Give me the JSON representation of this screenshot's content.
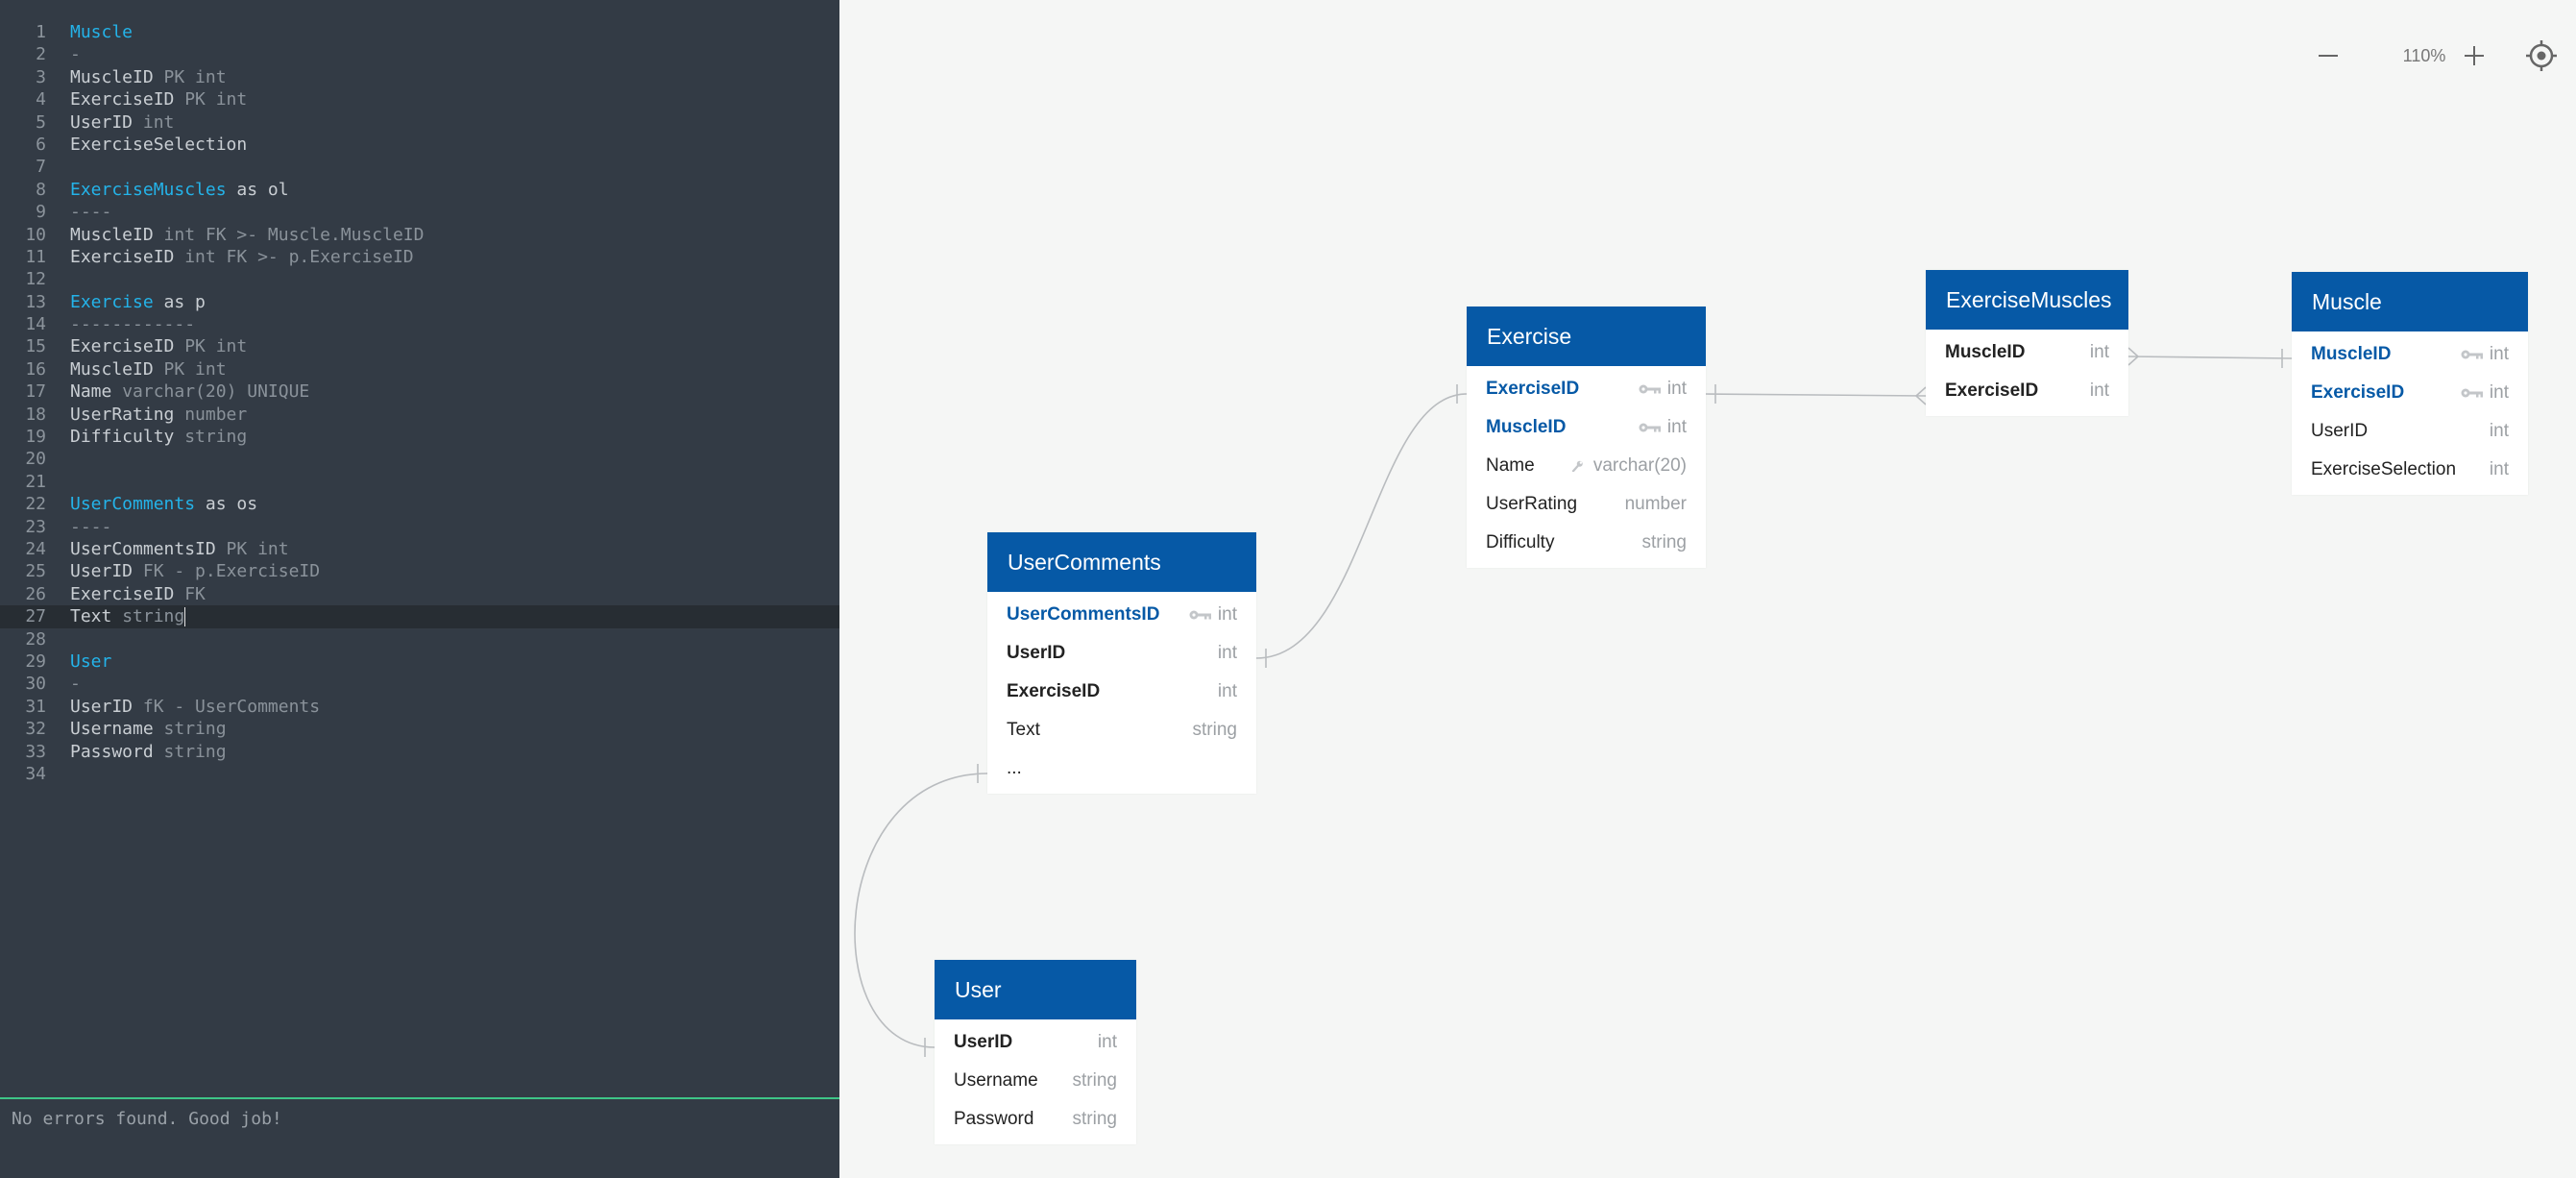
{
  "editor": {
    "lines": [
      {
        "n": "1",
        "t": "Muscle",
        "k": "name"
      },
      {
        "n": "2",
        "t": "-",
        "k": "dim"
      },
      {
        "n": "3",
        "t": "MuscleID",
        "r": " PK int",
        "k": "field"
      },
      {
        "n": "4",
        "t": "ExerciseID",
        "r": " PK int",
        "k": "field"
      },
      {
        "n": "5",
        "t": "UserID",
        "r": " int",
        "k": "field"
      },
      {
        "n": "6",
        "t": "ExerciseSelection",
        "k": "field"
      },
      {
        "n": "7",
        "t": "",
        "k": "field"
      },
      {
        "n": "8",
        "t": "ExerciseMuscles",
        "r": " as ol",
        "k": "name"
      },
      {
        "n": "9",
        "t": "----",
        "k": "dim"
      },
      {
        "n": "10",
        "t": "MuscleID",
        "r": " int FK >- Muscle.MuscleID",
        "k": "field"
      },
      {
        "n": "11",
        "t": "ExerciseID",
        "r": " int FK >- p.ExerciseID",
        "k": "field"
      },
      {
        "n": "12",
        "t": "",
        "k": "field"
      },
      {
        "n": "13",
        "t": "Exercise",
        "r": " as p",
        "k": "name"
      },
      {
        "n": "14",
        "t": "------------",
        "k": "dim"
      },
      {
        "n": "15",
        "t": "ExerciseID",
        "r": " PK int",
        "k": "field"
      },
      {
        "n": "16",
        "t": "MuscleID",
        "r": " PK int",
        "k": "field"
      },
      {
        "n": "17",
        "t": "Name",
        "r": " varchar(20) UNIQUE",
        "k": "field"
      },
      {
        "n": "18",
        "t": "UserRating",
        "r": " number",
        "k": "field"
      },
      {
        "n": "19",
        "t": "Difficulty",
        "r": " string",
        "k": "field"
      },
      {
        "n": "20",
        "t": "",
        "k": "field"
      },
      {
        "n": "21",
        "t": "",
        "k": "field"
      },
      {
        "n": "22",
        "t": "UserComments",
        "r": " as os",
        "k": "name"
      },
      {
        "n": "23",
        "t": "----",
        "k": "dim"
      },
      {
        "n": "24",
        "t": "UserCommentsID",
        "r": " PK int",
        "k": "field"
      },
      {
        "n": "25",
        "t": "UserID",
        "r": " FK - p.ExerciseID",
        "k": "field"
      },
      {
        "n": "26",
        "t": "ExerciseID",
        "r": " FK",
        "k": "field"
      },
      {
        "n": "27",
        "t": "Text",
        "r": " string",
        "k": "field",
        "active": true
      },
      {
        "n": "28",
        "t": "",
        "k": "field"
      },
      {
        "n": "29",
        "t": "User",
        "k": "name"
      },
      {
        "n": "30",
        "t": "-",
        "k": "dim"
      },
      {
        "n": "31",
        "t": "UserID",
        "r": " fK - UserComments",
        "k": "field"
      },
      {
        "n": "32",
        "t": "Username",
        "r": " string",
        "k": "field"
      },
      {
        "n": "33",
        "t": "Password",
        "r": " string",
        "k": "field"
      },
      {
        "n": "34",
        "t": "",
        "k": "field"
      }
    ],
    "status": "No errors found. Good job!"
  },
  "zoom": {
    "value": "110%"
  },
  "colors": {
    "header": "#0659a6",
    "keyword": "#24b3e9",
    "editor_bg": "#333b45",
    "status_line": "#3ec487"
  },
  "tables": {
    "exercise": {
      "title": "Exercise",
      "fields": [
        {
          "name": "ExerciseID",
          "type": "int",
          "style": "pk",
          "icon": "key-icon"
        },
        {
          "name": "MuscleID",
          "type": "int",
          "style": "pk",
          "icon": "key-icon"
        },
        {
          "name": "Name",
          "type": "varchar(20)",
          "style": "",
          "icon": "wrench-icon"
        },
        {
          "name": "UserRating",
          "type": "number",
          "style": ""
        },
        {
          "name": "Difficulty",
          "type": "string",
          "style": ""
        }
      ]
    },
    "exercise_muscles": {
      "title": "ExerciseMuscles",
      "fields": [
        {
          "name": "MuscleID",
          "type": "int",
          "style": "bold"
        },
        {
          "name": "ExerciseID",
          "type": "int",
          "style": "bold"
        }
      ]
    },
    "muscle": {
      "title": "Muscle",
      "fields": [
        {
          "name": "MuscleID",
          "type": "int",
          "style": "pk",
          "icon": "key-icon"
        },
        {
          "name": "ExerciseID",
          "type": "int",
          "style": "pk",
          "icon": "key-icon"
        },
        {
          "name": "UserID",
          "type": "int",
          "style": ""
        },
        {
          "name": "ExerciseSelection",
          "type": "int",
          "style": ""
        }
      ]
    },
    "user_comments": {
      "title": "UserComments",
      "fields": [
        {
          "name": "UserCommentsID",
          "type": "int",
          "style": "pk",
          "icon": "key-icon"
        },
        {
          "name": "UserID",
          "type": "int",
          "style": "bold"
        },
        {
          "name": "ExerciseID",
          "type": "int",
          "style": "bold"
        },
        {
          "name": "Text",
          "type": "string",
          "style": ""
        },
        {
          "name": "...",
          "type": "",
          "style": ""
        }
      ]
    },
    "user": {
      "title": "User",
      "fields": [
        {
          "name": "UserID",
          "type": "int",
          "style": "bold"
        },
        {
          "name": "Username",
          "type": "string",
          "style": ""
        },
        {
          "name": "Password",
          "type": "string",
          "style": ""
        }
      ]
    }
  }
}
